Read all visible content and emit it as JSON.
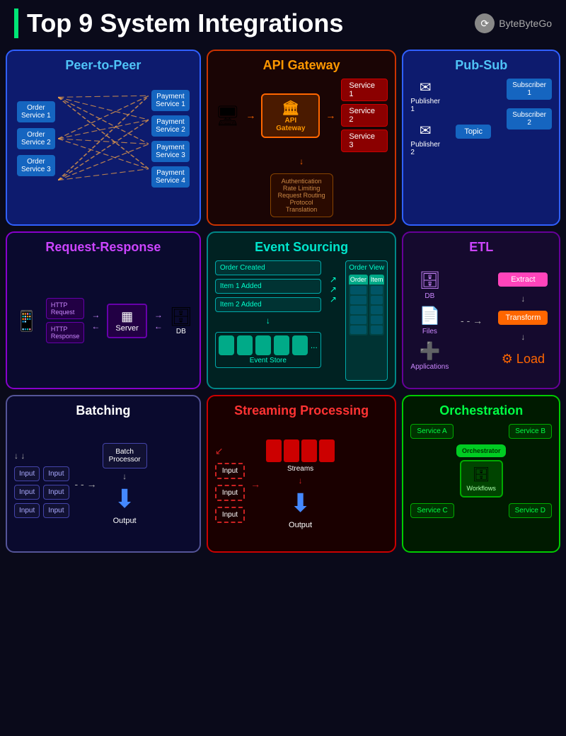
{
  "header": {
    "title": "Top 9 System Integrations",
    "logo": "ByteByteGo"
  },
  "cards": [
    {
      "id": "p2p",
      "title": "Peer-to-Peer",
      "left_services": [
        "Order\nService 1",
        "Order\nService 2",
        "Order\nService 3"
      ],
      "right_services": [
        "Payment\nService 1",
        "Payment\nService 2",
        "Payment\nService 3",
        "Payment\nService 4"
      ]
    },
    {
      "id": "api",
      "title": "API Gateway",
      "services": [
        "Service 1",
        "Service 2",
        "Service 3"
      ],
      "gateway_label": "API\nGateway",
      "auth_text": "Authentication\nRate Limiting\nRequest Routing\nProtocol\nTranslation"
    },
    {
      "id": "pubsub",
      "title": "Pub-Sub",
      "publishers": [
        "Publisher\n1",
        "Publisher\n2"
      ],
      "subscribers": [
        "Subscriber\n1",
        "Subscriber\n2"
      ],
      "topic": "Topic"
    },
    {
      "id": "reqres",
      "title": "Request-Response",
      "http_labels": [
        "HTTP\nRequest",
        "HTTP\nResponse"
      ],
      "server_label": "Server",
      "db_label": "DB"
    },
    {
      "id": "eventsrc",
      "title": "Event Sourcing",
      "events": [
        "Order Created",
        "Item 1 Added",
        "Item 2 Added"
      ],
      "order_view_title": "Order View",
      "cols": [
        "Order",
        "Item"
      ],
      "store_label": "Event Store"
    },
    {
      "id": "etl",
      "title": "ETL",
      "sources": [
        "DB",
        "Files",
        "Applications"
      ],
      "steps": [
        "Extract",
        "Transform",
        "Load"
      ]
    },
    {
      "id": "batching",
      "title": "Batching",
      "inputs": [
        "Input",
        "Input",
        "Input",
        "Input",
        "Input",
        "Input"
      ],
      "processor": "Batch\nProcessor",
      "output": "Output"
    },
    {
      "id": "streaming",
      "title": "Streaming Processing",
      "inputs": [
        "Input",
        "Input",
        "Input"
      ],
      "streams_label": "Streams",
      "output": "Output"
    },
    {
      "id": "orch",
      "title": "Orchestration",
      "services": [
        "Service A",
        "Service B",
        "Service C",
        "Service D"
      ],
      "orchestrator_label": "Orchestrator",
      "workflows_label": "Workflows"
    }
  ]
}
